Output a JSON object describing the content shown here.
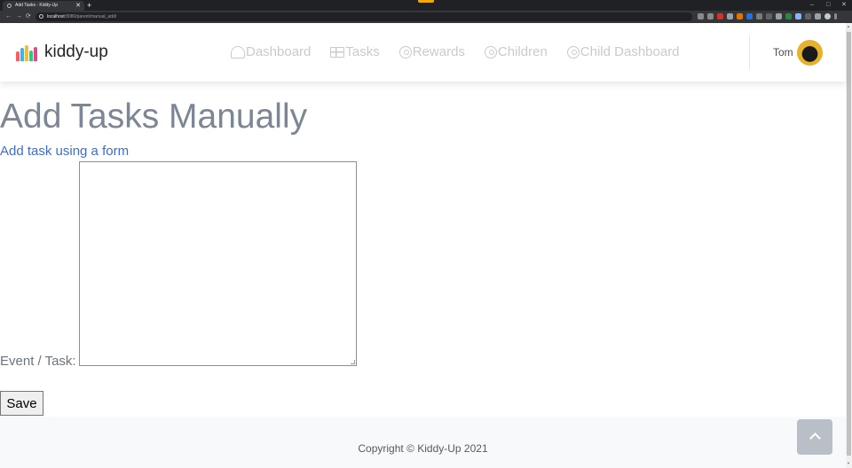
{
  "browser": {
    "tab_title": "Add Tasks - Kiddy-Up",
    "new_tab": "+",
    "url_host": "localhost",
    "url_path": ":8080/parent/manual_add/",
    "window_controls": [
      "–",
      "□",
      "✕"
    ]
  },
  "header": {
    "brand": "kiddy-up",
    "nav": [
      {
        "label": "Dashboard",
        "icon": "dashboard-gauge-icon"
      },
      {
        "label": "Tasks",
        "icon": "table-icon"
      },
      {
        "label": "Rewards",
        "icon": "user-circle-icon"
      },
      {
        "label": "Children",
        "icon": "user-circle-icon"
      },
      {
        "label": "Child Dashboard",
        "icon": "user-circle-icon"
      }
    ],
    "user_name": "Tom"
  },
  "main": {
    "title": "Add Tasks Manually",
    "subtitle_link": "Add task using a form",
    "field_label": "Event / Task:",
    "textarea_value": "",
    "save_label": "Save"
  },
  "footer": {
    "copyright": "Copyright © Kiddy-Up 2021"
  },
  "colors": {
    "title": "#7c8694",
    "link": "#3b6dd8",
    "nav": "#c7cbd0",
    "footer_bg": "#f8f9fa"
  }
}
